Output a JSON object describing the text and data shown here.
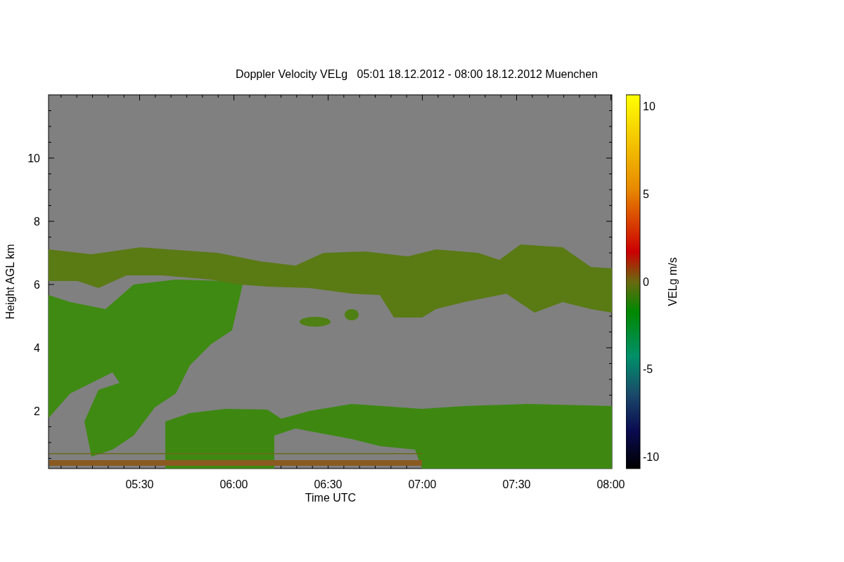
{
  "title": "Doppler Velocity VELg   05:01 18.12.2012 - 08:00 18.12.2012 Muenchen",
  "y_axis": {
    "label": "Height AGL km",
    "ticks": [
      "10",
      "8",
      "6",
      "4",
      "2"
    ]
  },
  "x_axis": {
    "label": "Time UTC",
    "ticks": [
      "05:30",
      "06:00",
      "06:30",
      "07:00",
      "07:30",
      "08:00"
    ]
  },
  "colorbar": {
    "label": "VELg m/s",
    "ticks": [
      "10",
      "5",
      "0",
      "-5",
      "-10"
    ]
  }
}
